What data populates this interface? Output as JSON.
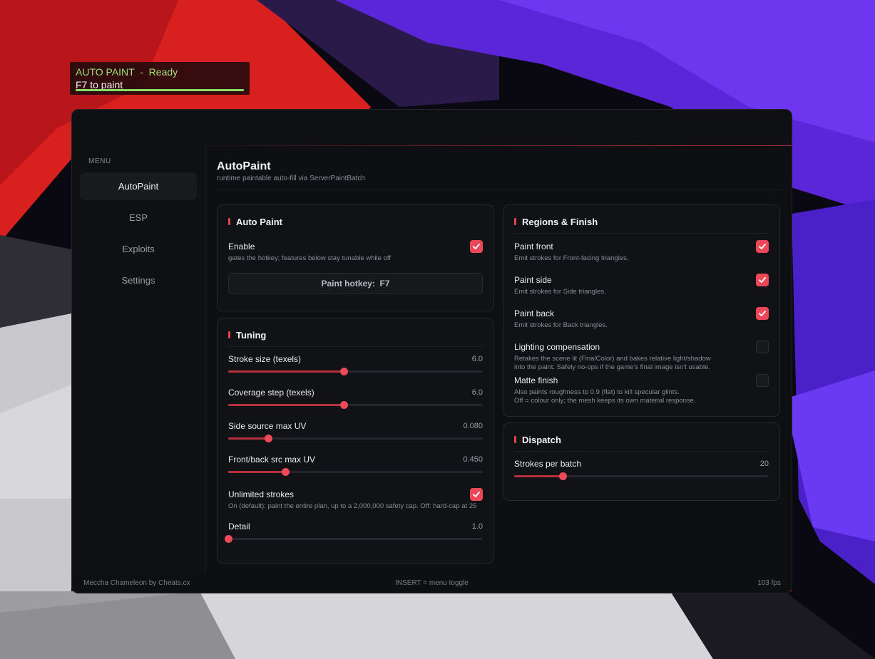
{
  "hud": {
    "title": "AUTO PAINT  -  Ready",
    "subtitle": "F7 to paint",
    "color": "#9ee27a"
  },
  "sidebar": {
    "menu_label": "MENU",
    "items": [
      {
        "label": "AutoPaint",
        "active": true
      },
      {
        "label": "ESP",
        "active": false
      },
      {
        "label": "Exploits",
        "active": false
      },
      {
        "label": "Settings",
        "active": false
      }
    ]
  },
  "page": {
    "title": "AutoPaint",
    "subtitle": "runtime paintable auto-fill via ServerPaintBatch"
  },
  "auto_paint": {
    "title": "Auto Paint",
    "enable_label": "Enable",
    "enable_desc": "gates the hotkey; features below stay tunable while off",
    "enable_checked": true,
    "hotkey_label": "Paint hotkey:  F7"
  },
  "tuning": {
    "title": "Tuning",
    "stroke_size": {
      "label": "Stroke size (texels)",
      "value": "6.0",
      "fraction": 0.455
    },
    "coverage_step": {
      "label": "Coverage step (texels)",
      "value": "6.0",
      "fraction": 0.455
    },
    "side_max_uv": {
      "label": "Side source max UV",
      "value": "0.080",
      "fraction": 0.157
    },
    "front_back_max_uv": {
      "label": "Front/back src max UV",
      "value": "0.450",
      "fraction": 0.225
    },
    "unlimited": {
      "label": "Unlimited strokes",
      "desc": "On (default): paint the entire plan, up to a 2,000,000 safety cap. Off: hard-cap at 25",
      "checked": true
    },
    "detail": {
      "label": "Detail",
      "value": "1.0",
      "fraction": 0.0
    }
  },
  "regions": {
    "title": "Regions & Finish",
    "paint_front": {
      "label": "Paint front",
      "desc": "Emit strokes for Front-facing triangles.",
      "checked": true
    },
    "paint_side": {
      "label": "Paint side",
      "desc": "Emit strokes for Side triangles.",
      "checked": true
    },
    "paint_back": {
      "label": "Paint back",
      "desc": "Emit strokes for Back triangles.",
      "checked": true
    },
    "lighting": {
      "label": "Lighting compensation",
      "desc1": "Retakes the scene lit (FinalColor) and bakes relative light/shadow",
      "desc2": "into the paint. Safely no-ops if the game's final image isn't usable.",
      "checked": false
    },
    "matte": {
      "label": "Matte finish",
      "desc1": "Also paints roughness to 0.9 (flat) to kill specular glints.",
      "desc2": "Off = colour only; the mesh keeps its own material response.",
      "checked": false
    }
  },
  "dispatch": {
    "title": "Dispatch",
    "strokes_per_batch": {
      "label": "Strokes per batch",
      "value": "20",
      "fraction": 0.19
    }
  },
  "footer": {
    "left": "Meccha Chameleon by Cheats.cx",
    "center": "INSERT = menu toggle",
    "right": "103 fps"
  },
  "colors": {
    "accent": "#ec4756",
    "slider_fill": "#b5323d",
    "bg": "#0e0f12"
  }
}
